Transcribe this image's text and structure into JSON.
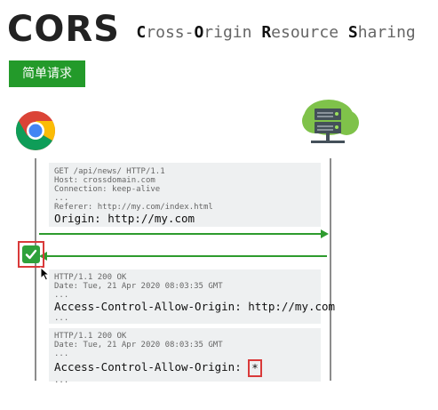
{
  "title": {
    "main": "CORS",
    "sub_parts": [
      {
        "initial": "C",
        "rest": "ross-"
      },
      {
        "initial": "O",
        "rest": "rigin "
      },
      {
        "initial": "R",
        "rest": "esource "
      },
      {
        "initial": "S",
        "rest": "haring"
      }
    ]
  },
  "tag": "简单请求",
  "icons": {
    "client": "chrome-browser-icon",
    "server": "server-cloud-icon",
    "check": "check-mark-icon",
    "cursor": "mouse-cursor-icon"
  },
  "colors": {
    "arrow": "#2e9b2e",
    "tag_bg": "#239a2a",
    "highlight": "#d93a3a",
    "panel_bg": "#eef0f1"
  },
  "request": {
    "lines": [
      "GET /api/news/ HTTP/1.1",
      "Host: crossdomain.com",
      "Connection: keep-alive",
      "...",
      "Referer: http://my.com/index.html"
    ],
    "origin": "Origin: http://my.com"
  },
  "response1": {
    "lines": [
      "HTTP/1.1 200 OK",
      "Date: Tue, 21 Apr 2020 08:03:35 GMT",
      "..."
    ],
    "header": "Access-Control-Allow-Origin: http://my.com",
    "tail": "..."
  },
  "response2": {
    "lines": [
      "HTTP/1.1 200 OK",
      "Date: Tue, 21 Apr 2020 08:03:35 GMT",
      "..."
    ],
    "header_name": "Access-Control-Allow-Origin: ",
    "header_value": "*",
    "tail": "..."
  }
}
